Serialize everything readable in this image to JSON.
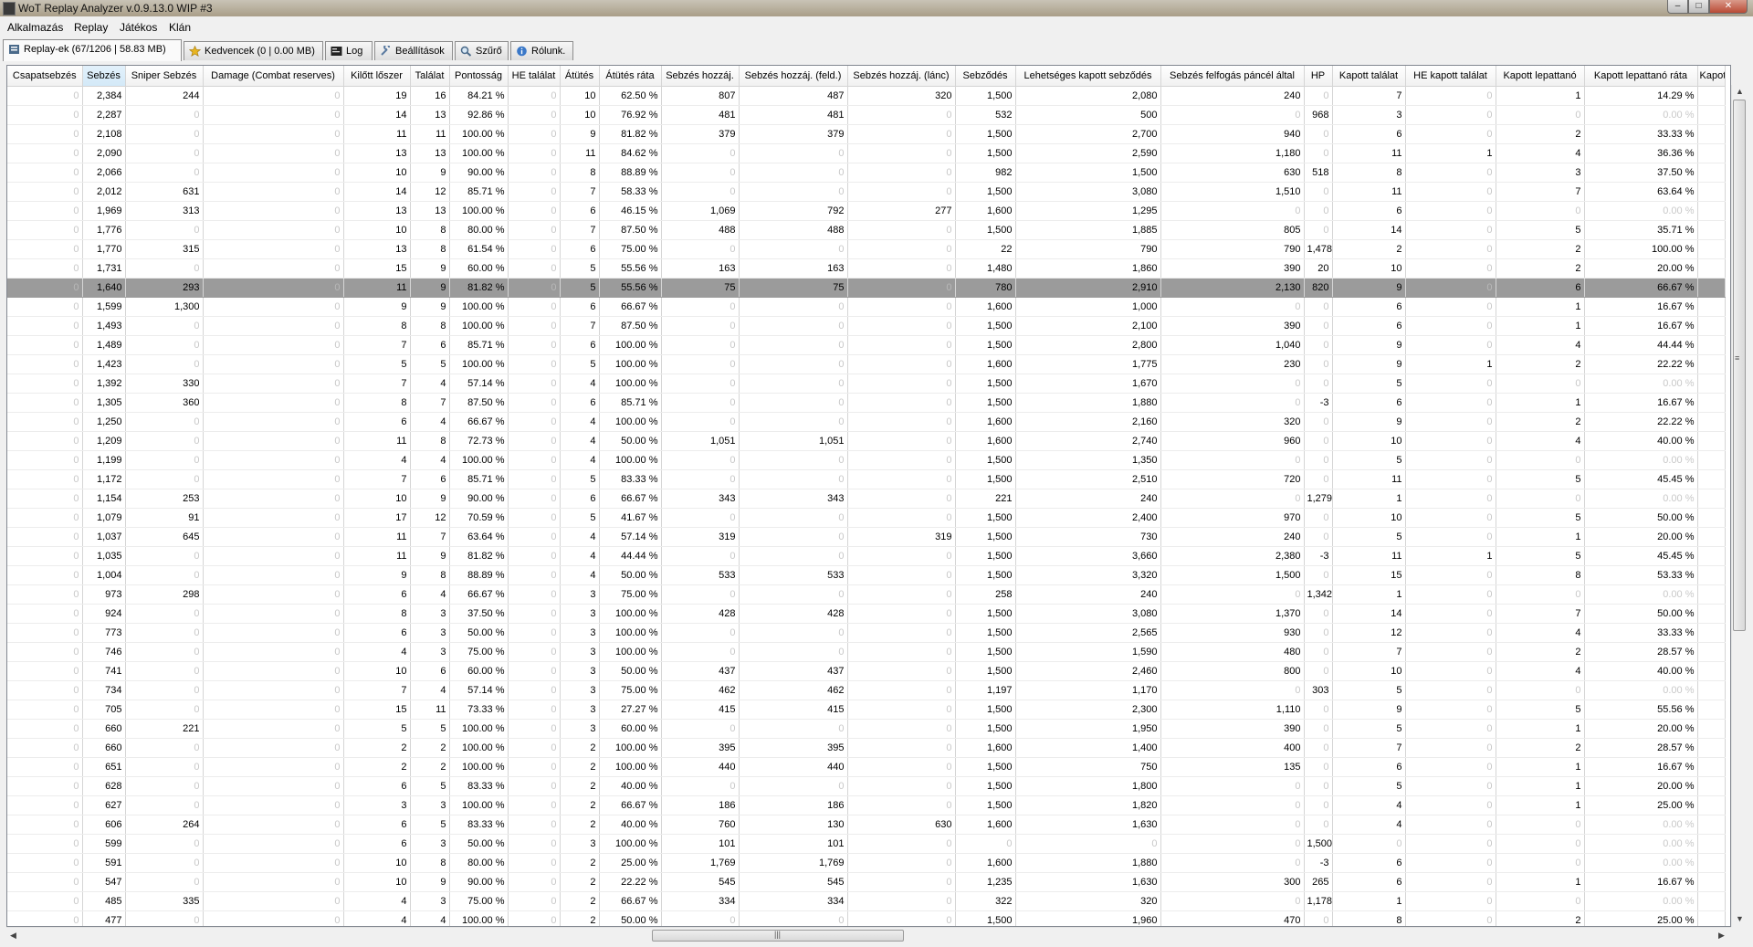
{
  "window": {
    "title": "WoT Replay Analyzer v.0.9.13.0 WIP #3",
    "buttons": {
      "minimize": "–",
      "maximize": "□",
      "close": "✕"
    }
  },
  "menu": [
    "Alkalmazás",
    "Replay",
    "Játékos",
    "Klán"
  ],
  "tabs": [
    {
      "label": "Replay-ek (67/1206 | 58.83 MB)",
      "icon": "replay-list-icon"
    },
    {
      "label": "Kedvencek (0 | 0.00 MB)",
      "icon": "star-icon"
    },
    {
      "label": "Log",
      "icon": "log-icon"
    },
    {
      "label": "Beállítások",
      "icon": "settings-icon"
    },
    {
      "label": "Szűrő",
      "icon": "magnifier-icon"
    },
    {
      "label": "Rólunk.",
      "icon": "info-icon"
    }
  ],
  "table": {
    "columns": [
      "Csapatsebzés",
      "Sebzés",
      "Sniper Sebzés",
      "Damage (Combat reserves)",
      "Kilőtt lőszer",
      "Találat",
      "Pontosság",
      "HE találat",
      "Átütés",
      "Átütés ráta",
      "Sebzés hozzáj.",
      "Sebzés hozzáj. (feld.)",
      "Sebzés hozzáj. (lánc)",
      "Sebződés",
      "Lehetséges kapott sebződés",
      "Sebzés felfogás páncél által",
      "HP",
      "Kapott találat",
      "HE kapott találat",
      "Kapott lepattanó",
      "Kapott lepattanó ráta",
      "Kapot"
    ],
    "sorted_column": "Sebzés",
    "selected_row": 10,
    "rows": [
      [
        "0",
        "2,384",
        "244",
        "0",
        "19",
        "16",
        "84.21 %",
        "0",
        "10",
        "62.50 %",
        "807",
        "487",
        "320",
        "1,500",
        "2,080",
        "240",
        "0",
        "7",
        "0",
        "1",
        "14.29 %",
        ""
      ],
      [
        "0",
        "2,287",
        "0",
        "0",
        "14",
        "13",
        "92.86 %",
        "0",
        "10",
        "76.92 %",
        "481",
        "481",
        "0",
        "532",
        "500",
        "0",
        "968",
        "3",
        "0",
        "0",
        "0.00 %",
        ""
      ],
      [
        "0",
        "2,108",
        "0",
        "0",
        "11",
        "11",
        "100.00 %",
        "0",
        "9",
        "81.82 %",
        "379",
        "379",
        "0",
        "1,500",
        "2,700",
        "940",
        "0",
        "6",
        "0",
        "2",
        "33.33 %",
        ""
      ],
      [
        "0",
        "2,090",
        "0",
        "0",
        "13",
        "13",
        "100.00 %",
        "0",
        "11",
        "84.62 %",
        "0",
        "0",
        "0",
        "1,500",
        "2,590",
        "1,180",
        "0",
        "11",
        "1",
        "4",
        "36.36 %",
        ""
      ],
      [
        "0",
        "2,066",
        "0",
        "0",
        "10",
        "9",
        "90.00 %",
        "0",
        "8",
        "88.89 %",
        "0",
        "0",
        "0",
        "982",
        "1,500",
        "630",
        "518",
        "8",
        "0",
        "3",
        "37.50 %",
        ""
      ],
      [
        "0",
        "2,012",
        "631",
        "0",
        "14",
        "12",
        "85.71 %",
        "0",
        "7",
        "58.33 %",
        "0",
        "0",
        "0",
        "1,500",
        "3,080",
        "1,510",
        "0",
        "11",
        "0",
        "7",
        "63.64 %",
        ""
      ],
      [
        "0",
        "1,969",
        "313",
        "0",
        "13",
        "13",
        "100.00 %",
        "0",
        "6",
        "46.15 %",
        "1,069",
        "792",
        "277",
        "1,600",
        "1,295",
        "0",
        "0",
        "6",
        "0",
        "0",
        "0.00 %",
        ""
      ],
      [
        "0",
        "1,776",
        "0",
        "0",
        "10",
        "8",
        "80.00 %",
        "0",
        "7",
        "87.50 %",
        "488",
        "488",
        "0",
        "1,500",
        "1,885",
        "805",
        "0",
        "14",
        "0",
        "5",
        "35.71 %",
        ""
      ],
      [
        "0",
        "1,770",
        "315",
        "0",
        "13",
        "8",
        "61.54 %",
        "0",
        "6",
        "75.00 %",
        "0",
        "0",
        "0",
        "22",
        "790",
        "790",
        "1,478",
        "2",
        "0",
        "2",
        "100.00 %",
        ""
      ],
      [
        "0",
        "1,731",
        "0",
        "0",
        "15",
        "9",
        "60.00 %",
        "0",
        "5",
        "55.56 %",
        "163",
        "163",
        "0",
        "1,480",
        "1,860",
        "390",
        "20",
        "10",
        "0",
        "2",
        "20.00 %",
        ""
      ],
      [
        "0",
        "1,640",
        "293",
        "0",
        "11",
        "9",
        "81.82 %",
        "0",
        "5",
        "55.56 %",
        "75",
        "75",
        "0",
        "780",
        "2,910",
        "2,130",
        "820",
        "9",
        "0",
        "6",
        "66.67 %",
        ""
      ],
      [
        "0",
        "1,599",
        "1,300",
        "0",
        "9",
        "9",
        "100.00 %",
        "0",
        "6",
        "66.67 %",
        "0",
        "0",
        "0",
        "1,600",
        "1,000",
        "0",
        "0",
        "6",
        "0",
        "1",
        "16.67 %",
        ""
      ],
      [
        "0",
        "1,493",
        "0",
        "0",
        "8",
        "8",
        "100.00 %",
        "0",
        "7",
        "87.50 %",
        "0",
        "0",
        "0",
        "1,500",
        "2,100",
        "390",
        "0",
        "6",
        "0",
        "1",
        "16.67 %",
        ""
      ],
      [
        "0",
        "1,489",
        "0",
        "0",
        "7",
        "6",
        "85.71 %",
        "0",
        "6",
        "100.00 %",
        "0",
        "0",
        "0",
        "1,500",
        "2,800",
        "1,040",
        "0",
        "9",
        "0",
        "4",
        "44.44 %",
        ""
      ],
      [
        "0",
        "1,423",
        "0",
        "0",
        "5",
        "5",
        "100.00 %",
        "0",
        "5",
        "100.00 %",
        "0",
        "0",
        "0",
        "1,600",
        "1,775",
        "230",
        "0",
        "9",
        "1",
        "2",
        "22.22 %",
        ""
      ],
      [
        "0",
        "1,392",
        "330",
        "0",
        "7",
        "4",
        "57.14 %",
        "0",
        "4",
        "100.00 %",
        "0",
        "0",
        "0",
        "1,500",
        "1,670",
        "0",
        "0",
        "5",
        "0",
        "0",
        "0.00 %",
        ""
      ],
      [
        "0",
        "1,305",
        "360",
        "0",
        "8",
        "7",
        "87.50 %",
        "0",
        "6",
        "85.71 %",
        "0",
        "0",
        "0",
        "1,500",
        "1,880",
        "0",
        "-3",
        "6",
        "0",
        "1",
        "16.67 %",
        ""
      ],
      [
        "0",
        "1,250",
        "0",
        "0",
        "6",
        "4",
        "66.67 %",
        "0",
        "4",
        "100.00 %",
        "0",
        "0",
        "0",
        "1,600",
        "2,160",
        "320",
        "0",
        "9",
        "0",
        "2",
        "22.22 %",
        ""
      ],
      [
        "0",
        "1,209",
        "0",
        "0",
        "11",
        "8",
        "72.73 %",
        "0",
        "4",
        "50.00 %",
        "1,051",
        "1,051",
        "0",
        "1,600",
        "2,740",
        "960",
        "0",
        "10",
        "0",
        "4",
        "40.00 %",
        ""
      ],
      [
        "0",
        "1,199",
        "0",
        "0",
        "4",
        "4",
        "100.00 %",
        "0",
        "4",
        "100.00 %",
        "0",
        "0",
        "0",
        "1,500",
        "1,350",
        "0",
        "0",
        "5",
        "0",
        "0",
        "0.00 %",
        ""
      ],
      [
        "0",
        "1,172",
        "0",
        "0",
        "7",
        "6",
        "85.71 %",
        "0",
        "5",
        "83.33 %",
        "0",
        "0",
        "0",
        "1,500",
        "2,510",
        "720",
        "0",
        "11",
        "0",
        "5",
        "45.45 %",
        ""
      ],
      [
        "0",
        "1,154",
        "253",
        "0",
        "10",
        "9",
        "90.00 %",
        "0",
        "6",
        "66.67 %",
        "343",
        "343",
        "0",
        "221",
        "240",
        "0",
        "1,279",
        "1",
        "0",
        "0",
        "0.00 %",
        ""
      ],
      [
        "0",
        "1,079",
        "91",
        "0",
        "17",
        "12",
        "70.59 %",
        "0",
        "5",
        "41.67 %",
        "0",
        "0",
        "0",
        "1,500",
        "2,400",
        "970",
        "0",
        "10",
        "0",
        "5",
        "50.00 %",
        ""
      ],
      [
        "0",
        "1,037",
        "645",
        "0",
        "11",
        "7",
        "63.64 %",
        "0",
        "4",
        "57.14 %",
        "319",
        "0",
        "319",
        "1,500",
        "730",
        "240",
        "0",
        "5",
        "0",
        "1",
        "20.00 %",
        ""
      ],
      [
        "0",
        "1,035",
        "0",
        "0",
        "11",
        "9",
        "81.82 %",
        "0",
        "4",
        "44.44 %",
        "0",
        "0",
        "0",
        "1,500",
        "3,660",
        "2,380",
        "-3",
        "11",
        "1",
        "5",
        "45.45 %",
        ""
      ],
      [
        "0",
        "1,004",
        "0",
        "0",
        "9",
        "8",
        "88.89 %",
        "0",
        "4",
        "50.00 %",
        "533",
        "533",
        "0",
        "1,500",
        "3,320",
        "1,500",
        "0",
        "15",
        "0",
        "8",
        "53.33 %",
        ""
      ],
      [
        "0",
        "973",
        "298",
        "0",
        "6",
        "4",
        "66.67 %",
        "0",
        "3",
        "75.00 %",
        "0",
        "0",
        "0",
        "258",
        "240",
        "0",
        "1,342",
        "1",
        "0",
        "0",
        "0.00 %",
        ""
      ],
      [
        "0",
        "924",
        "0",
        "0",
        "8",
        "3",
        "37.50 %",
        "0",
        "3",
        "100.00 %",
        "428",
        "428",
        "0",
        "1,500",
        "3,080",
        "1,370",
        "0",
        "14",
        "0",
        "7",
        "50.00 %",
        ""
      ],
      [
        "0",
        "773",
        "0",
        "0",
        "6",
        "3",
        "50.00 %",
        "0",
        "3",
        "100.00 %",
        "0",
        "0",
        "0",
        "1,500",
        "2,565",
        "930",
        "0",
        "12",
        "0",
        "4",
        "33.33 %",
        ""
      ],
      [
        "0",
        "746",
        "0",
        "0",
        "4",
        "3",
        "75.00 %",
        "0",
        "3",
        "100.00 %",
        "0",
        "0",
        "0",
        "1,500",
        "1,590",
        "480",
        "0",
        "7",
        "0",
        "2",
        "28.57 %",
        ""
      ],
      [
        "0",
        "741",
        "0",
        "0",
        "10",
        "6",
        "60.00 %",
        "0",
        "3",
        "50.00 %",
        "437",
        "437",
        "0",
        "1,500",
        "2,460",
        "800",
        "0",
        "10",
        "0",
        "4",
        "40.00 %",
        ""
      ],
      [
        "0",
        "734",
        "0",
        "0",
        "7",
        "4",
        "57.14 %",
        "0",
        "3",
        "75.00 %",
        "462",
        "462",
        "0",
        "1,197",
        "1,170",
        "0",
        "303",
        "5",
        "0",
        "0",
        "0.00 %",
        ""
      ],
      [
        "0",
        "705",
        "0",
        "0",
        "15",
        "11",
        "73.33 %",
        "0",
        "3",
        "27.27 %",
        "415",
        "415",
        "0",
        "1,500",
        "2,300",
        "1,110",
        "0",
        "9",
        "0",
        "5",
        "55.56 %",
        ""
      ],
      [
        "0",
        "660",
        "221",
        "0",
        "5",
        "5",
        "100.00 %",
        "0",
        "3",
        "60.00 %",
        "0",
        "0",
        "0",
        "1,500",
        "1,950",
        "390",
        "0",
        "5",
        "0",
        "1",
        "20.00 %",
        ""
      ],
      [
        "0",
        "660",
        "0",
        "0",
        "2",
        "2",
        "100.00 %",
        "0",
        "2",
        "100.00 %",
        "395",
        "395",
        "0",
        "1,600",
        "1,400",
        "400",
        "0",
        "7",
        "0",
        "2",
        "28.57 %",
        ""
      ],
      [
        "0",
        "651",
        "0",
        "0",
        "2",
        "2",
        "100.00 %",
        "0",
        "2",
        "100.00 %",
        "440",
        "440",
        "0",
        "1,500",
        "750",
        "135",
        "0",
        "6",
        "0",
        "1",
        "16.67 %",
        ""
      ],
      [
        "0",
        "628",
        "0",
        "0",
        "6",
        "5",
        "83.33 %",
        "0",
        "2",
        "40.00 %",
        "0",
        "0",
        "0",
        "1,500",
        "1,800",
        "0",
        "0",
        "5",
        "0",
        "1",
        "20.00 %",
        ""
      ],
      [
        "0",
        "627",
        "0",
        "0",
        "3",
        "3",
        "100.00 %",
        "0",
        "2",
        "66.67 %",
        "186",
        "186",
        "0",
        "1,500",
        "1,820",
        "0",
        "0",
        "4",
        "0",
        "1",
        "25.00 %",
        ""
      ],
      [
        "0",
        "606",
        "264",
        "0",
        "6",
        "5",
        "83.33 %",
        "0",
        "2",
        "40.00 %",
        "760",
        "130",
        "630",
        "1,600",
        "1,630",
        "0",
        "0",
        "4",
        "0",
        "0",
        "0.00 %",
        ""
      ],
      [
        "0",
        "599",
        "0",
        "0",
        "6",
        "3",
        "50.00 %",
        "0",
        "3",
        "100.00 %",
        "101",
        "101",
        "0",
        "0",
        "0",
        "0",
        "1,500",
        "0",
        "0",
        "0",
        "0.00 %",
        ""
      ],
      [
        "0",
        "591",
        "0",
        "0",
        "10",
        "8",
        "80.00 %",
        "0",
        "2",
        "25.00 %",
        "1,769",
        "1,769",
        "0",
        "1,600",
        "1,880",
        "0",
        "-3",
        "6",
        "0",
        "0",
        "0.00 %",
        ""
      ],
      [
        "0",
        "547",
        "0",
        "0",
        "10",
        "9",
        "90.00 %",
        "0",
        "2",
        "22.22 %",
        "545",
        "545",
        "0",
        "1,235",
        "1,630",
        "300",
        "265",
        "6",
        "0",
        "1",
        "16.67 %",
        ""
      ],
      [
        "0",
        "485",
        "335",
        "0",
        "4",
        "3",
        "75.00 %",
        "0",
        "2",
        "66.67 %",
        "334",
        "334",
        "0",
        "322",
        "320",
        "0",
        "1,178",
        "1",
        "0",
        "0",
        "0.00 %",
        ""
      ],
      [
        "0",
        "477",
        "0",
        "0",
        "4",
        "4",
        "100.00 %",
        "0",
        "2",
        "50.00 %",
        "0",
        "0",
        "0",
        "1,500",
        "1,960",
        "470",
        "0",
        "8",
        "0",
        "2",
        "25.00 %",
        ""
      ]
    ]
  }
}
